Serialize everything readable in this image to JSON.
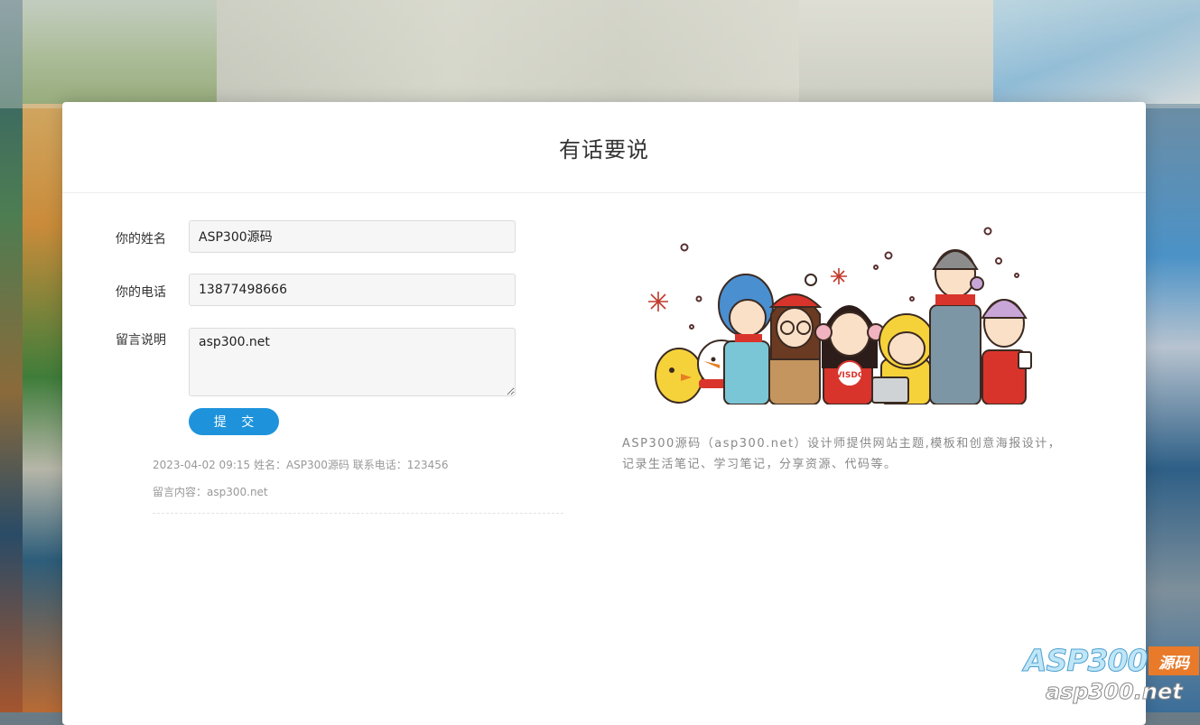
{
  "page": {
    "title": "有话要说"
  },
  "form": {
    "name": {
      "label": "你的姓名",
      "value": "ASP300源码"
    },
    "phone": {
      "label": "你的电话",
      "value": "13877498666"
    },
    "message": {
      "label": "留言说明",
      "value": "asp300.net"
    },
    "submit_label": "提 交"
  },
  "messages": [
    {
      "meta": "2023-04-02 09:15 姓名：ASP300源码 联系电话：123456",
      "content": "留言内容：asp300.net"
    }
  ],
  "sidebar": {
    "illustration_badge": "VISDC",
    "description": "ASP300源码（asp300.net）设计师提供网站主题,模板和创意海报设计，记录生活笔记、学习笔记，分享资源、代码等。"
  },
  "watermark": {
    "brand": "ASP300",
    "tag": "源码",
    "url": "asp300.net"
  },
  "colors": {
    "accent": "#1e93dc",
    "card_bg": "#ffffff",
    "field_bg": "#f6f6f6"
  }
}
